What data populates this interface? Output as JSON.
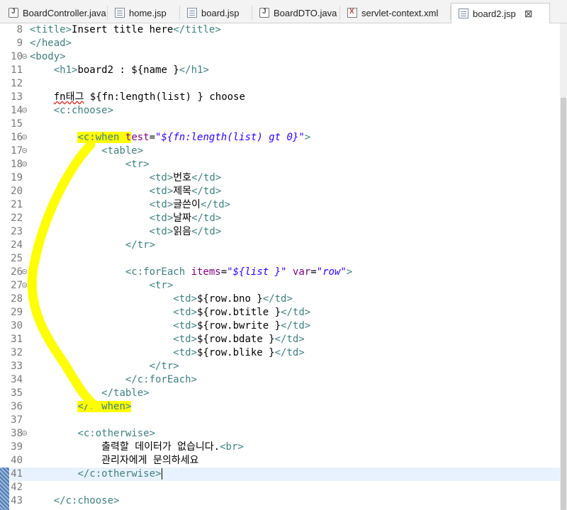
{
  "tabs": [
    {
      "label": "BoardController.java",
      "icon": "java-file-icon",
      "active": false
    },
    {
      "label": "home.jsp",
      "icon": "jsp-file-icon",
      "active": false
    },
    {
      "label": "board.jsp",
      "icon": "jsp-file-icon",
      "active": false
    },
    {
      "label": "BoardDTO.java",
      "icon": "java-file-icon",
      "active": false
    },
    {
      "label": "servlet-context.xml",
      "icon": "xml-file-icon",
      "active": false
    },
    {
      "label": "board2.jsp",
      "icon": "jsp-file-icon",
      "active": true
    }
  ],
  "tab_close": "⊠",
  "editor": {
    "current_line": 41,
    "lines": [
      {
        "n": "8",
        "fold": false,
        "segs": [
          [
            "tag",
            "<title>"
          ],
          [
            "t",
            "Insert title here"
          ],
          [
            "tag",
            "</title>"
          ]
        ]
      },
      {
        "n": "9",
        "fold": false,
        "segs": [
          [
            "tag",
            "</head>"
          ]
        ]
      },
      {
        "n": "10",
        "fold": true,
        "segs": [
          [
            "tag",
            "<body>"
          ]
        ]
      },
      {
        "n": "11",
        "fold": false,
        "segs": [
          [
            "t",
            "    "
          ],
          [
            "tag",
            "<h1>"
          ],
          [
            "t",
            "board2 : ${name }"
          ],
          [
            "tag",
            "</h1>"
          ]
        ]
      },
      {
        "n": "12",
        "fold": false,
        "segs": []
      },
      {
        "n": "13",
        "fold": false,
        "segs": [
          [
            "t",
            "    "
          ],
          [
            "err",
            "fn태그"
          ],
          [
            "t",
            " ${fn:length(list) } choose"
          ]
        ]
      },
      {
        "n": "14",
        "fold": true,
        "segs": [
          [
            "t",
            "    "
          ],
          [
            "tag",
            "<c:choose>"
          ]
        ]
      },
      {
        "n": "15",
        "fold": false,
        "segs": []
      },
      {
        "n": "16",
        "fold": true,
        "segs": [
          [
            "t",
            "        "
          ],
          [
            "taghl",
            "<c:when "
          ],
          [
            "attrhl",
            "t"
          ],
          [
            "attr",
            "est"
          ],
          [
            "t",
            "="
          ],
          [
            "val",
            "\"${fn:length(list) gt 0}\""
          ],
          [
            "tag",
            ">"
          ]
        ]
      },
      {
        "n": "17",
        "fold": true,
        "segs": [
          [
            "t",
            "            "
          ],
          [
            "tag",
            "<table>"
          ]
        ]
      },
      {
        "n": "18",
        "fold": true,
        "segs": [
          [
            "t",
            "                "
          ],
          [
            "tag",
            "<tr>"
          ]
        ]
      },
      {
        "n": "19",
        "fold": false,
        "segs": [
          [
            "t",
            "                    "
          ],
          [
            "tag",
            "<td>"
          ],
          [
            "t",
            "번호"
          ],
          [
            "tag",
            "</td>"
          ]
        ]
      },
      {
        "n": "20",
        "fold": false,
        "segs": [
          [
            "t",
            "                    "
          ],
          [
            "tag",
            "<td>"
          ],
          [
            "t",
            "제목"
          ],
          [
            "tag",
            "</td>"
          ]
        ]
      },
      {
        "n": "21",
        "fold": false,
        "segs": [
          [
            "t",
            "                    "
          ],
          [
            "tag",
            "<td>"
          ],
          [
            "t",
            "글쓴이"
          ],
          [
            "tag",
            "</td>"
          ]
        ]
      },
      {
        "n": "22",
        "fold": false,
        "segs": [
          [
            "t",
            "                    "
          ],
          [
            "tag",
            "<td>"
          ],
          [
            "t",
            "날짜"
          ],
          [
            "tag",
            "</td>"
          ]
        ]
      },
      {
        "n": "23",
        "fold": false,
        "segs": [
          [
            "t",
            "                    "
          ],
          [
            "tag",
            "<td>"
          ],
          [
            "t",
            "읽음"
          ],
          [
            "tag",
            "</td>"
          ]
        ]
      },
      {
        "n": "24",
        "fold": false,
        "segs": [
          [
            "t",
            "                "
          ],
          [
            "tag",
            "</tr>"
          ]
        ]
      },
      {
        "n": "25",
        "fold": false,
        "segs": []
      },
      {
        "n": "26",
        "fold": true,
        "segs": [
          [
            "t",
            "                "
          ],
          [
            "tag",
            "<c:forEach "
          ],
          [
            "attr",
            "items"
          ],
          [
            "t",
            "="
          ],
          [
            "val",
            "\"${list }\""
          ],
          [
            "t",
            " "
          ],
          [
            "attr",
            "var"
          ],
          [
            "t",
            "="
          ],
          [
            "val",
            "\"row\""
          ],
          [
            "tag",
            ">"
          ]
        ]
      },
      {
        "n": "27",
        "fold": true,
        "segs": [
          [
            "t",
            "                    "
          ],
          [
            "tag",
            "<tr>"
          ]
        ]
      },
      {
        "n": "28",
        "fold": false,
        "segs": [
          [
            "t",
            "                        "
          ],
          [
            "tag",
            "<td>"
          ],
          [
            "t",
            "${row.bno }"
          ],
          [
            "tag",
            "</td>"
          ]
        ]
      },
      {
        "n": "29",
        "fold": false,
        "segs": [
          [
            "t",
            "                        "
          ],
          [
            "tag",
            "<td>"
          ],
          [
            "t",
            "${row.btitle }"
          ],
          [
            "tag",
            "</td>"
          ]
        ]
      },
      {
        "n": "30",
        "fold": false,
        "segs": [
          [
            "t",
            "                        "
          ],
          [
            "tag",
            "<td>"
          ],
          [
            "t",
            "${row.bwrite }"
          ],
          [
            "tag",
            "</td>"
          ]
        ]
      },
      {
        "n": "31",
        "fold": false,
        "segs": [
          [
            "t",
            "                        "
          ],
          [
            "tag",
            "<td>"
          ],
          [
            "t",
            "${row.bdate }"
          ],
          [
            "tag",
            "</td>"
          ]
        ]
      },
      {
        "n": "32",
        "fold": false,
        "segs": [
          [
            "t",
            "                        "
          ],
          [
            "tag",
            "<td>"
          ],
          [
            "t",
            "${row.blike }"
          ],
          [
            "tag",
            "</td>"
          ]
        ]
      },
      {
        "n": "33",
        "fold": false,
        "segs": [
          [
            "t",
            "                    "
          ],
          [
            "tag",
            "</tr>"
          ]
        ]
      },
      {
        "n": "34",
        "fold": false,
        "segs": [
          [
            "t",
            "                "
          ],
          [
            "tag",
            "</c:forEach>"
          ]
        ]
      },
      {
        "n": "35",
        "fold": false,
        "segs": [
          [
            "t",
            "            "
          ],
          [
            "tag",
            "</table>"
          ]
        ]
      },
      {
        "n": "36",
        "fold": false,
        "segs": [
          [
            "t",
            "        "
          ],
          [
            "taghl",
            "</c:when>"
          ]
        ]
      },
      {
        "n": "37",
        "fold": false,
        "segs": []
      },
      {
        "n": "38",
        "fold": true,
        "segs": [
          [
            "t",
            "        "
          ],
          [
            "tag",
            "<c:otherwise>"
          ]
        ]
      },
      {
        "n": "39",
        "fold": false,
        "segs": [
          [
            "t",
            "            출력할 데이터가 없습니다."
          ],
          [
            "tag",
            "<br>"
          ]
        ]
      },
      {
        "n": "40",
        "fold": false,
        "segs": [
          [
            "t",
            "            관리자에게 문의하세요"
          ]
        ]
      },
      {
        "n": "41",
        "fold": false,
        "segs": [
          [
            "t",
            "        "
          ],
          [
            "tag",
            "</c:otherwise>"
          ]
        ]
      },
      {
        "n": "42",
        "fold": false,
        "segs": []
      },
      {
        "n": "43",
        "fold": false,
        "segs": [
          [
            "t",
            "    "
          ],
          [
            "tag",
            "</c:choose>"
          ]
        ]
      }
    ]
  },
  "colors": {
    "tag": "#3f7f7f",
    "attribute": "#7f007f",
    "string": "#2a00ff",
    "highlighter": "#ffff00",
    "current_line": "#e8f2fe"
  }
}
